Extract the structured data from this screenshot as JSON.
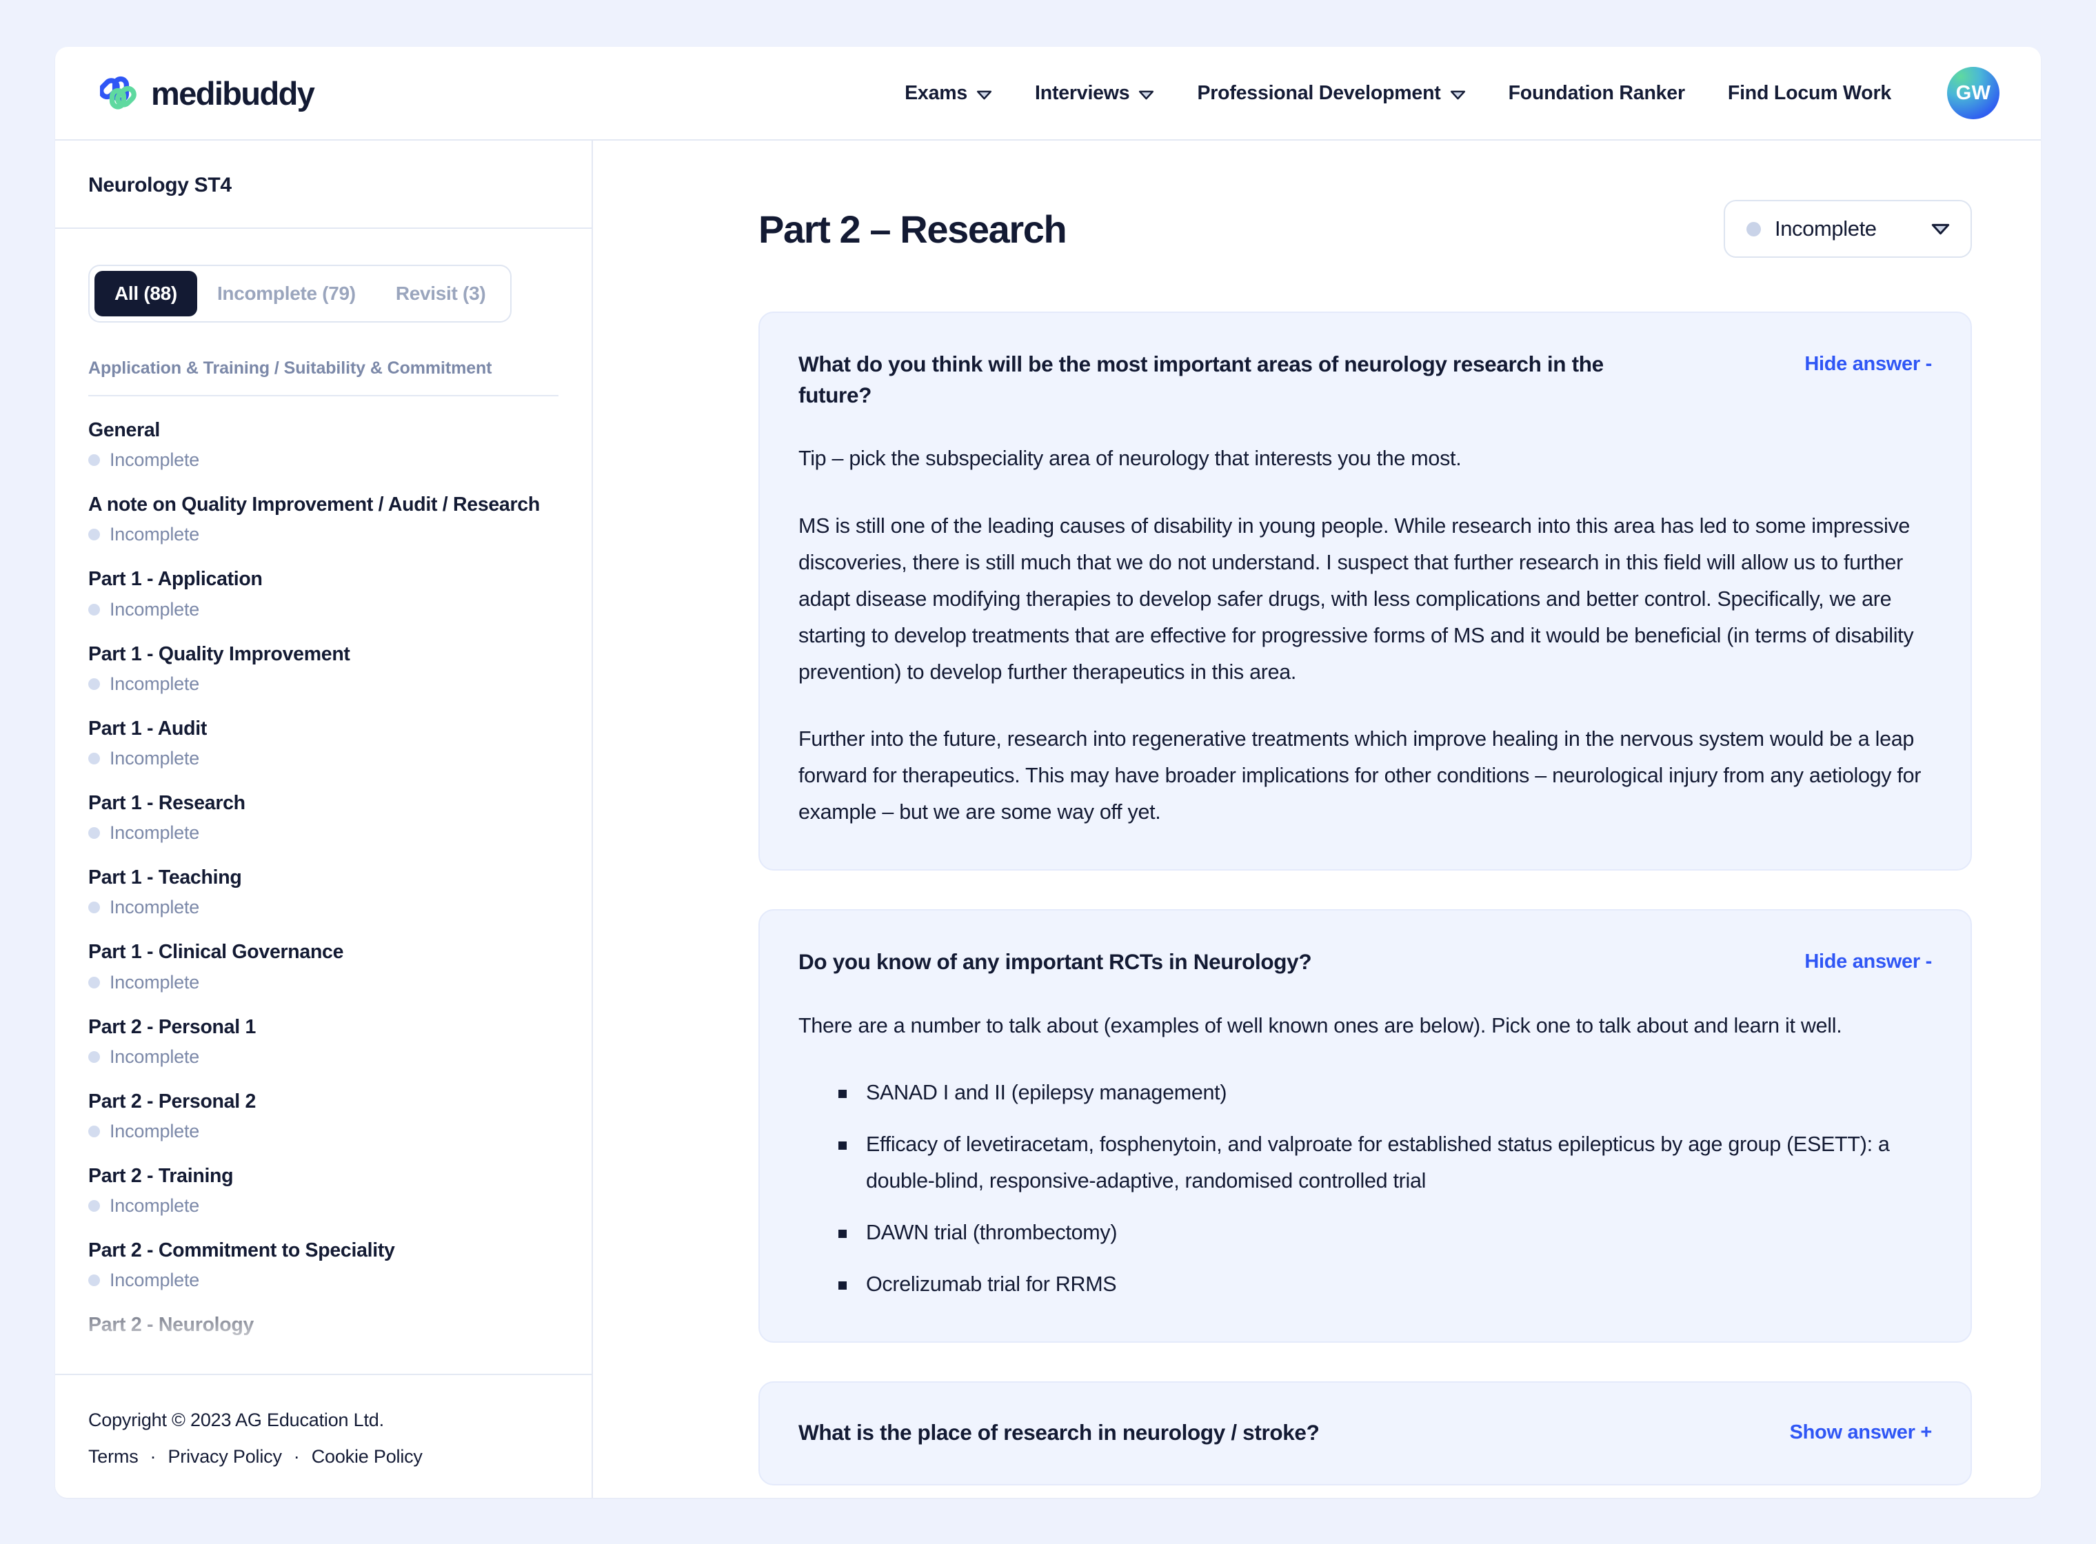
{
  "brand": {
    "name": "medibuddy",
    "logo_icon": "medibuddy-link-logo"
  },
  "nav": {
    "items": [
      {
        "label": "Exams",
        "has_dropdown": true
      },
      {
        "label": "Interviews",
        "has_dropdown": true
      },
      {
        "label": "Professional Development",
        "has_dropdown": true
      },
      {
        "label": "Foundation Ranker",
        "has_dropdown": false
      },
      {
        "label": "Find Locum Work",
        "has_dropdown": false
      }
    ],
    "avatar_initials": "GW"
  },
  "sidebar": {
    "title": "Neurology ST4",
    "filters": [
      {
        "label": "All (88)",
        "active": true
      },
      {
        "label": "Incomplete (79)",
        "active": false
      },
      {
        "label": "Revisit (3)",
        "active": false
      }
    ],
    "group_label": "Application & Training / Suitability & Commitment",
    "items": [
      {
        "label": "General",
        "status": "Incomplete"
      },
      {
        "label": "A note on Quality Improvement / Audit / Research",
        "status": "Incomplete"
      },
      {
        "label": "Part 1 - Application",
        "status": "Incomplete"
      },
      {
        "label": "Part 1 - Quality Improvement",
        "status": "Incomplete"
      },
      {
        "label": "Part 1 - Audit",
        "status": "Incomplete"
      },
      {
        "label": "Part 1 - Research",
        "status": "Incomplete"
      },
      {
        "label": "Part 1 - Teaching",
        "status": "Incomplete"
      },
      {
        "label": "Part 1 - Clinical Governance",
        "status": "Incomplete"
      },
      {
        "label": "Part 2 - Personal 1",
        "status": "Incomplete"
      },
      {
        "label": "Part 2 - Personal 2",
        "status": "Incomplete"
      },
      {
        "label": "Part 2 - Training",
        "status": "Incomplete"
      },
      {
        "label": "Part 2 - Commitment to Speciality",
        "status": "Incomplete"
      },
      {
        "label": "Part 2 - Neurology",
        "status": ""
      }
    ],
    "footer": {
      "copyright": "Copyright © 2023 AG Education Ltd.",
      "links": [
        "Terms",
        "Privacy Policy",
        "Cookie Policy"
      ],
      "separator": "·"
    }
  },
  "main": {
    "page_title": "Part 2 – Research",
    "status": {
      "value": "Incomplete",
      "dot_color": "#c9d3e8"
    },
    "cards": [
      {
        "question": "What do you think will be the most important areas of neurology research in the future?",
        "toggle_label": "Hide answer -",
        "expanded": true,
        "paragraphs": [
          "Tip – pick the subspeciality area of neurology that interests you the most.",
          "MS is still one of the leading causes of disability in young people. While research into this area has led to some impressive discoveries, there is still much that we do not understand. I suspect that further research in this field will allow us to further adapt disease modifying therapies to develop safer drugs, with less complications and better control. Specifically, we are starting to develop treatments that are effective for progressive forms of MS and it would be beneficial (in terms of disability prevention) to develop further therapeutics in this area.",
          "Further into the future, research into regenerative treatments which improve healing in the nervous system would be a leap forward for therapeutics. This may have broader implications for other conditions – neurological injury from any aetiology for example – but we are some way off yet."
        ],
        "bullets": []
      },
      {
        "question": "Do you know of any important RCTs in Neurology?",
        "toggle_label": "Hide answer -",
        "expanded": true,
        "paragraphs": [
          "There are a number to talk about (examples of well known ones are below). Pick one to talk about and learn it well."
        ],
        "bullets": [
          "SANAD I and II (epilepsy management)",
          "Efficacy of levetiracetam, fosphenytoin, and valproate for established status epilepticus by age group (ESETT): a double-blind, responsive-adaptive, randomised controlled trial",
          "DAWN trial (thrombectomy)",
          "Ocrelizumab trial for RRMS"
        ]
      },
      {
        "question": "What is the place of research in neurology / stroke?",
        "toggle_label": "Show answer +",
        "expanded": false,
        "paragraphs": [],
        "bullets": []
      }
    ]
  },
  "colors": {
    "page_background": "#eef2fd",
    "card_background": "#f0f4fe",
    "accent_link": "#2f56f5",
    "text_dark": "#131a33",
    "text_muted": "#7b88a8",
    "logo_blue": "#2f56f5",
    "logo_green": "#5fd9a0"
  }
}
